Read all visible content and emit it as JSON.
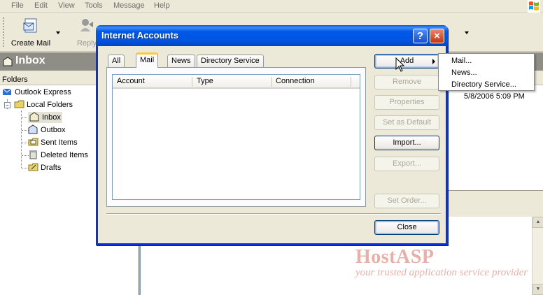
{
  "menubar": {
    "items": [
      "File",
      "Edit",
      "View",
      "Tools",
      "Message",
      "Help"
    ]
  },
  "toolbar": {
    "create_mail": "Create Mail",
    "reply": "Reply"
  },
  "inbox_bar": {
    "title": "Inbox"
  },
  "folders": {
    "header": "Folders",
    "tree": [
      "Outlook Express",
      "Local Folders",
      "Inbox",
      "Outbox",
      "Sent Items",
      "Deleted Items",
      "Drafts"
    ]
  },
  "message_list": {
    "date": "5/8/2006 5:09 PM"
  },
  "dialog": {
    "title": "Internet Accounts",
    "help_btn": "?",
    "close_btn": "×",
    "tabs": [
      "All",
      "Mail",
      "News",
      "Directory Service"
    ],
    "active_tab": "Mail",
    "columns": [
      "Account",
      "Type",
      "Connection"
    ],
    "buttons": {
      "add": "Add",
      "remove": "Remove",
      "properties": "Properties",
      "set_default": "Set as Default",
      "import": "Import...",
      "export": "Export...",
      "set_order": "Set Order...",
      "close": "Close"
    }
  },
  "add_menu": {
    "items": [
      "Mail...",
      "News...",
      "Directory Service..."
    ]
  },
  "watermark": {
    "brand": "HostASP",
    "tagline": "your trusted application service provider"
  },
  "colors": {
    "titlebar": "#0055e3",
    "watermark": "#e7b0a8"
  }
}
